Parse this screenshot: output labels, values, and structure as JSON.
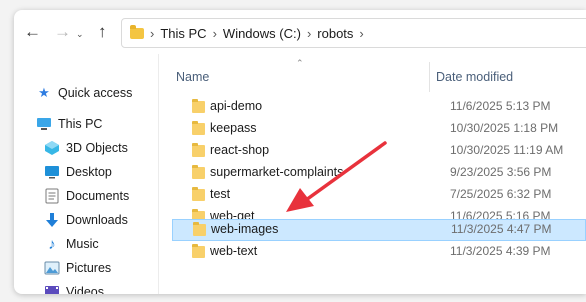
{
  "toolbar": {
    "back_icon": "arrow-left-icon",
    "forward_icon": "arrow-right-icon",
    "recent_icon": "chevron-down-icon",
    "up_icon": "arrow-up-icon"
  },
  "address": {
    "crumbs": [
      "This PC",
      "Windows (C:)",
      "robots"
    ]
  },
  "sidebar": {
    "items": [
      {
        "label": "Quick access",
        "icon": "star-icon"
      },
      {
        "label": "This PC",
        "icon": "monitor-icon"
      },
      {
        "label": "3D Objects",
        "icon": "cube-icon"
      },
      {
        "label": "Desktop",
        "icon": "desktop-icon"
      },
      {
        "label": "Documents",
        "icon": "document-icon"
      },
      {
        "label": "Downloads",
        "icon": "download-icon"
      },
      {
        "label": "Music",
        "icon": "music-icon"
      },
      {
        "label": "Pictures",
        "icon": "picture-icon"
      },
      {
        "label": "Videos",
        "icon": "video-icon"
      }
    ]
  },
  "columns": {
    "name": "Name",
    "date": "Date modified"
  },
  "files": [
    {
      "name": "api-demo",
      "date": "11/6/2025 5:13 PM"
    },
    {
      "name": "keepass",
      "date": "10/30/2025 1:18 PM"
    },
    {
      "name": "react-shop",
      "date": "10/30/2025 11:19 AM"
    },
    {
      "name": "supermarket-complaints",
      "date": "9/23/2025 3:56 PM"
    },
    {
      "name": "test",
      "date": "7/25/2025 6:32 PM"
    },
    {
      "name": "web-get",
      "date": "11/6/2025 5:16 PM"
    },
    {
      "name": "web-images",
      "date": "11/3/2025 4:47 PM",
      "selected": true
    },
    {
      "name": "web-text",
      "date": "11/3/2025 4:39 PM"
    }
  ],
  "colors": {
    "selection_bg": "#cce8ff",
    "selection_border": "#99d1ff",
    "annotation_arrow": "#e8323c",
    "folder": "#f8d06a"
  }
}
